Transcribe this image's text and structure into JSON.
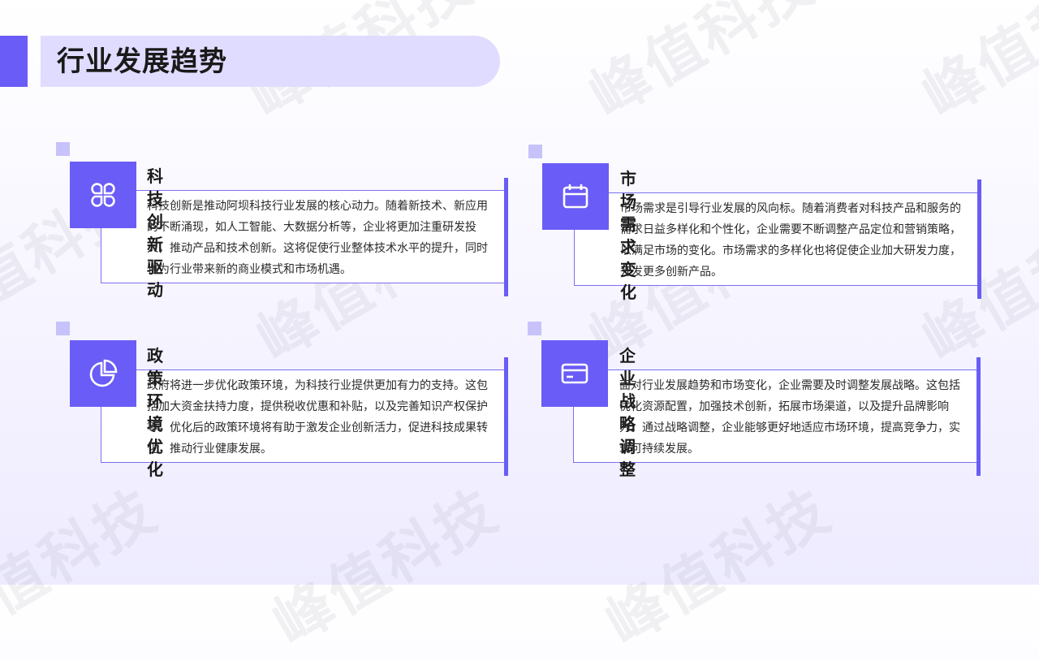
{
  "watermark_text": "峰值科技",
  "page_title": "行业发展趋势",
  "colors": {
    "accent": "#6a5cf6",
    "pill": "#e0dcff",
    "deco": "#c8c2fb"
  },
  "cards": [
    {
      "icon": "grid-icon",
      "title": "科技创新驱动",
      "text": "科技创新是推动阿坝科技行业发展的核心动力。随着新技术、新应用的不断涌现，如人工智能、大数据分析等，企业将更加注重研发投入，推动产品和技术创新。这将促使行业整体技术水平的提升，同时也为行业带来新的商业模式和市场机遇。"
    },
    {
      "icon": "calendar-icon",
      "title": "市场需求变化",
      "text": "市场需求是引导行业发展的风向标。随着消费者对科技产品和服务的需求日益多样化和个性化，企业需要不断调整产品定位和营销策略，以满足市场的变化。市场需求的多样化也将促使企业加大研发力度，开发更多创新产品。"
    },
    {
      "icon": "pie-chart-icon",
      "title": "政策环境优化",
      "text": "政府将进一步优化政策环境，为科技行业提供更加有力的支持。这包括加大资金扶持力度，提供税收优惠和补贴，以及完善知识产权保护等。优化后的政策环境将有助于激发企业创新活力，促进科技成果转化，推动行业健康发展。"
    },
    {
      "icon": "card-icon",
      "title": "企业战略调整",
      "text": "面对行业发展趋势和市场变化，企业需要及时调整发展战略。这包括优化资源配置，加强技术创新，拓展市场渠道，以及提升品牌影响力。通过战略调整，企业能够更好地适应市场环境，提高竞争力，实现可持续发展。"
    }
  ]
}
